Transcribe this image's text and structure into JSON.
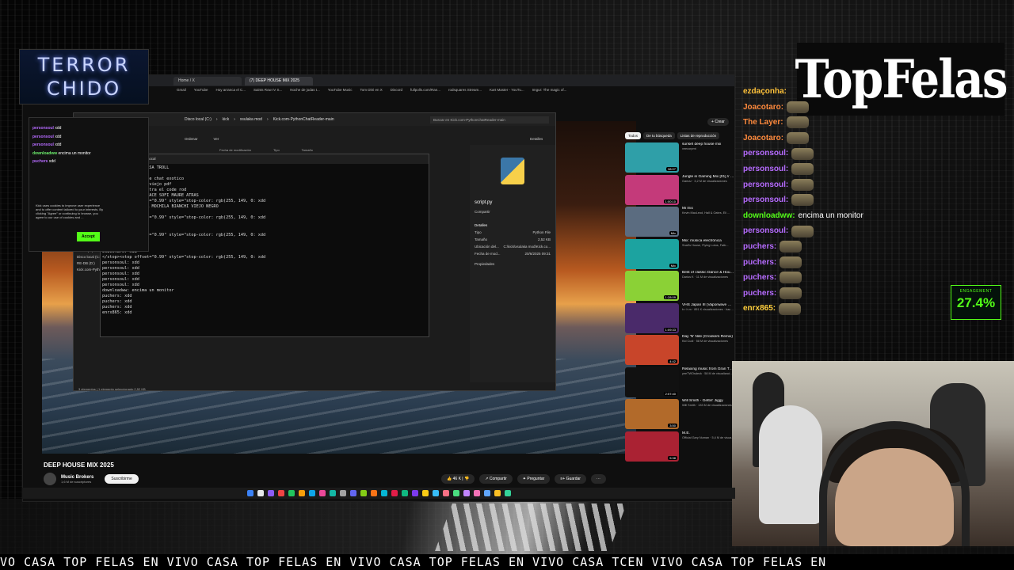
{
  "overlay": {
    "left_logo_line1": "TERROR",
    "left_logo_line2": "CHIDO",
    "right_logo": "TopFelas",
    "ticker_text": "VO CASA TOP FELAS EN VIVO CASA TOP FELAS EN VIVO CASA TOP FELAS EN VIVO CASA TCEN VIVO CASA TOP FELAS EN",
    "engagement_label": "ENGAGEMENT",
    "engagement_value": "27.4%"
  },
  "browser": {
    "tabs": [
      "Home / X",
      "(7) DEEP HOUSE MIX 2025"
    ],
    "bookmarks": [
      "Gmail",
      "YouTube",
      "Hoy arranca el C...",
      "Saints Row IV S...",
      "Noche de jodas t...",
      "YouTube Music",
      "Tom Ditri en X",
      "Discord",
      "fullpolls.com/Ran...",
      "rodsquares Stream...",
      "Kart Master - YouTu...",
      "Imgur: The magic of..."
    ]
  },
  "youtube": {
    "video_title": "DEEP HOUSE MIX 2025",
    "channel_name": "Music Brokers",
    "channel_subs": "1,6 M de suscriptores",
    "subscribe_label": "Suscribirme",
    "likes": "46 K",
    "share_label": "Compartir",
    "ask_label": "Preguntar",
    "save_label": "Guardar",
    "create_label": "Crear",
    "chips": [
      "Todos",
      "De tu búsqueda",
      "Listas de reproducción"
    ],
    "recommendations": [
      {
        "title": "sunset deep house mix",
        "meta": "veecorpmt",
        "duration": "38:07",
        "color": "#2f9fa8"
      },
      {
        "title": "Jungle in Gaming Mix [01] // PS1, N64, Xbox // 1hr Drum and...",
        "meta": "Gamzz · 3,2 M de visualizaciones",
        "duration": "1:00:10",
        "color": "#c43a7a"
      },
      {
        "title": "Mi mix",
        "meta": "Kevin MacLeod, Hall & Oates, Eli ...",
        "duration": "Mix",
        "color": "#5b6c80"
      },
      {
        "title": "Mix: música electrónica",
        "meta": "Snail's House, Flying Lotus, Fatb...",
        "duration": "Mix",
        "color": "#1ca3a0"
      },
      {
        "title": "Best of classic Dance & House 80s, 90, 2000s",
        "meta": "Darius K · 11 M de visualizaciones",
        "duration": "1:28:09",
        "color": "#8bd136"
      },
      {
        "title": "VHS Japan III (Vaporwave Mix)",
        "meta": "b r h m · 891 K visualizaciones · hace 5 años",
        "duration": "1:09:33",
        "color": "#4a2a6a"
      },
      {
        "title": "Day 'N' Nite (Crookers Remix)",
        "meta": "Kid Cudi · 58 M de visualizaciones",
        "duration": "4:42",
        "color": "#c8452a"
      },
      {
        "title": "Relaxing music from Gran Turismo (#1)",
        "meta": "yeeTWOsdeck · 58 M de visualizaciones",
        "duration": "2:57:40",
        "color": "#111111"
      },
      {
        "title": "Will Smith - Gettin' Jiggy",
        "meta": "Will Smith · 133 M de visualizaciones",
        "duration": "3:50",
        "color": "#b26a2a"
      },
      {
        "title": "M.E.",
        "meta": "Official Gary Numan · 5,4 M de visualizaciones",
        "duration": "5:38",
        "color": "#aa2233"
      }
    ]
  },
  "explorer": {
    "breadcrumb": [
      "Disco local (C:)",
      "kick",
      "xsulaka mod",
      "Kick.com-PythonChatReader-main"
    ],
    "search_placeholder": "Buscar en Kick.com-PythonChatReader-main",
    "toolbar": [
      "Ordenar",
      "Ver",
      "Detalles"
    ],
    "columns": [
      "Fecha de modificación",
      "Tipo",
      "Tamaño"
    ],
    "file_name": "script.py",
    "share_label": "Compartir",
    "details_label": "Detalles",
    "details": [
      {
        "k": "Tipo",
        "v": "Python File"
      },
      {
        "k": "Tamaño",
        "v": "2,52 KB"
      },
      {
        "k": "Ubicación del...",
        "v": "C:\\kick\\xsulaka mod\\Kick.co..."
      },
      {
        "k": "Fecha de mod...",
        "v": "20/6/2025 09:31"
      }
    ],
    "properties_label": "Propiedades",
    "sidebar": [
      "Este equipo",
      "Disco local (C:)",
      "RE-DB (D:)",
      "Kick.com-PythonChatReac"
    ],
    "status": "3 elementos | 1 elemento seleccionado 2,52 KB"
  },
  "terminal": {
    "tab_title": "C:\\Users\\roll\\AppData\\Local",
    "lines": [
      "mochosobased: LA CASA TROLL",
      "Trollface_63: hola",
      "g8nn_1: me gusta ese chat exotico",
      "CoreTroll: Bianchi viejo pdf",
      "DoctorMedicina: mostra el code rod",
      "mochosobased: QUE HACE SOFI MAURE ATRAS",
      "</stop><stop offset=\"0.99\" style=\"stop-color: rgb(255, 149, 0: xdd",
      "eliasepp: SACATE LA MOCHILA BIANCHI VIEJO NEGRO",
      "LoboSoldier: xdd",
      "</stop><stop offset=\"0.99\" style=\"stop-color: rgb(255, 149, 0: xdd",
      "LoboSoldier: xdd",
      "Joacotaro: xdd",
      "</stop><stop offset=\"0.99\" style=\"stop-color: rgb(255, 149, 0: xdd",
      "Joacotaro: xdd",
      "Joacotaro: xdd",
      "Joacotaro: xdd",
      "</stop><stop offset=\"0.99\" style=\"stop-color: rgb(255, 149, 0: xdd",
      "personsoul: xdd",
      "personsoul: xdd",
      "personsoul: xdd",
      "personsoul: xdd",
      "personsoul: xdd",
      "downloadww: encima un monitor",
      "puchers: xdd",
      "puchers: xdd",
      "puchers: xdd",
      "enrx865: xdd"
    ]
  },
  "left_chat": {
    "lines": [
      {
        "user": "personsoul",
        "msg": "xdd",
        "green": false
      },
      {
        "user": "personsoul",
        "msg": "xdd",
        "green": false
      },
      {
        "user": "personsoul",
        "msg": "xdd",
        "green": false
      },
      {
        "user": "downloadww",
        "msg": "encima un monitor",
        "green": true
      },
      {
        "user": "puchers",
        "msg": "xdd",
        "green": false
      }
    ],
    "cookie_text": "Kick uses cookies to improve user experience and to offer content tailored to your interests. By clicking \"Agree\" or continuing to browse, you agree to our use of cookies and ...",
    "accept_label": "Accept"
  },
  "right_chat": {
    "lines": [
      {
        "user": "ezdaçonha",
        "msg": "",
        "cls": "c",
        "emote": false
      },
      {
        "user": "Joacotaro",
        "msg": "",
        "cls": "o",
        "emote": true
      },
      {
        "user": "The Layer",
        "msg": "",
        "cls": "o",
        "emote": true
      },
      {
        "user": "Joacotaro",
        "msg": "",
        "cls": "o",
        "emote": true
      },
      {
        "user": "personsoul",
        "msg": "",
        "cls": "",
        "emote": true
      },
      {
        "user": "personsoul",
        "msg": "",
        "cls": "",
        "emote": true
      },
      {
        "user": "personsoul",
        "msg": "",
        "cls": "",
        "emote": true
      },
      {
        "user": "personsoul",
        "msg": "",
        "cls": "",
        "emote": true
      },
      {
        "user": "downloadww",
        "msg": "encima un monitor",
        "cls": "g",
        "emote": false
      },
      {
        "user": "personsoul",
        "msg": "",
        "cls": "",
        "emote": true
      },
      {
        "user": "puchers",
        "msg": "",
        "cls": "",
        "emote": true
      },
      {
        "user": "puchers",
        "msg": "",
        "cls": "",
        "emote": true
      },
      {
        "user": "puchers",
        "msg": "",
        "cls": "",
        "emote": true
      },
      {
        "user": "puchers",
        "msg": "",
        "cls": "",
        "emote": true
      },
      {
        "user": "enrx865",
        "msg": "",
        "cls": "y",
        "emote": true
      }
    ]
  },
  "taskbar_icons": [
    "#3b82f6",
    "#e5e7eb",
    "#8b5cf6",
    "#ef4444",
    "#22c55e",
    "#f59e0b",
    "#0ea5e9",
    "#ec4899",
    "#14b8a6",
    "#a3a3a3",
    "#6366f1",
    "#84cc16",
    "#f97316",
    "#06b6d4",
    "#e11d48",
    "#10b981",
    "#7c3aed",
    "#facc15",
    "#38bdf8",
    "#fb7185",
    "#4ade80",
    "#c084fc",
    "#f472b6",
    "#60a5fa",
    "#fbbf24",
    "#34d399"
  ]
}
